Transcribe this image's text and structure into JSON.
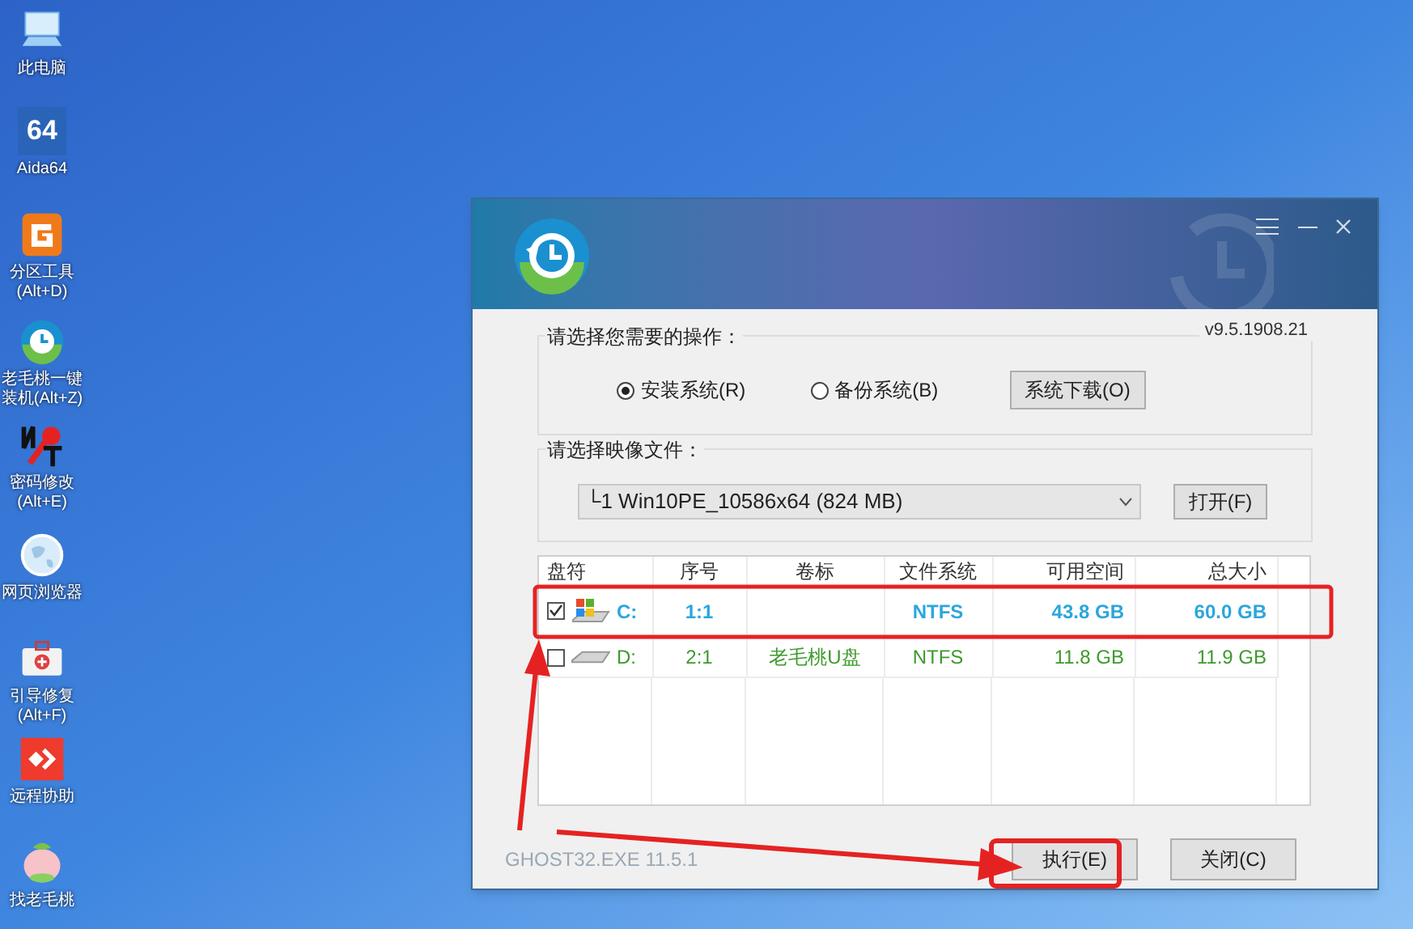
{
  "desktop_icons": [
    {
      "kind": "pc",
      "lines": [
        "此电脑"
      ]
    },
    {
      "kind": "aida",
      "lines": [
        "Aida64"
      ],
      "icon_text": "64"
    },
    {
      "kind": "partition",
      "lines": [
        "分区工具",
        "(Alt+D)"
      ]
    },
    {
      "kind": "installer",
      "lines": [
        "老毛桃一键",
        "装机(Alt+Z)"
      ]
    },
    {
      "kind": "password",
      "lines": [
        "密码修改",
        "(Alt+E)"
      ]
    },
    {
      "kind": "browser",
      "lines": [
        "网页浏览器"
      ]
    },
    {
      "kind": "repair",
      "lines": [
        "引导修复",
        "(Alt+F)"
      ]
    },
    {
      "kind": "remote",
      "lines": [
        "远程协助"
      ]
    },
    {
      "kind": "mascot",
      "lines": [
        "找老毛桃"
      ]
    }
  ],
  "window": {
    "version": "v9.5.1908.21",
    "operation_group": {
      "title": "请选择您需要的操作：",
      "options": [
        {
          "label": "安装系统(R)",
          "selected": true
        },
        {
          "label": "备份系统(B)",
          "selected": false
        }
      ],
      "button": "系统下载(O)"
    },
    "image_group": {
      "title": "请选择映像文件：",
      "dropdown_value": "└1 Win10PE_10586x64 (824 MB)",
      "button": "打开(F)"
    },
    "table": {
      "columns": [
        "盘符",
        "序号",
        "卷标",
        "文件系统",
        "可用空间",
        "总大小"
      ],
      "rows": [
        {
          "kind": "system",
          "checked": true,
          "color": "#2ba6dc",
          "cells": [
            "C:",
            "1:1",
            "",
            "NTFS",
            "43.8 GB",
            "60.0 GB"
          ]
        },
        {
          "kind": "drive",
          "checked": false,
          "color": "#3d9a2c",
          "cells": [
            "D:",
            "2:1",
            "老毛桃U盘",
            "NTFS",
            "11.8 GB",
            "11.9 GB"
          ]
        }
      ]
    },
    "footer_text": "GHOST32.EXE 11.5.1",
    "buttons": [
      "执行(E)",
      "关闭(C)"
    ]
  }
}
